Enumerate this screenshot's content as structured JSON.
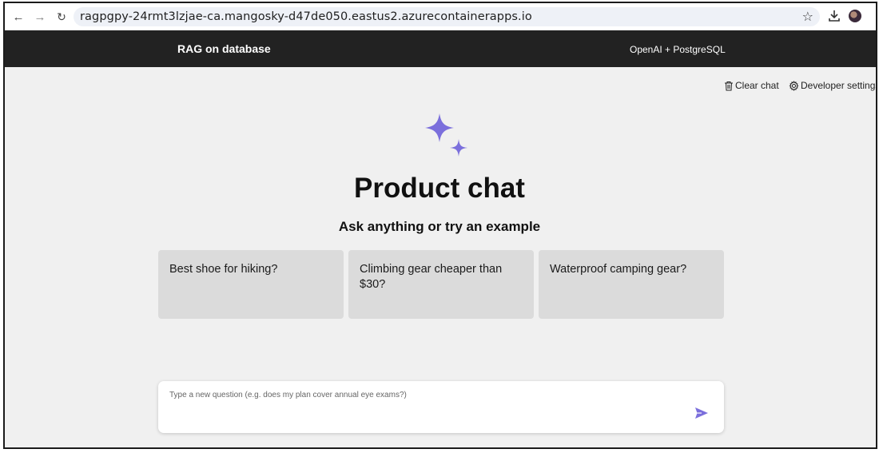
{
  "browser": {
    "url": "ragpgpy-24rmt3lzjae-ca.mangosky-d47de050.eastus2.azurecontainerapps.io",
    "back_icon": "arrow-left-icon",
    "forward_icon": "arrow-right-icon",
    "reload_icon": "reload-icon",
    "bookmark_icon": "star-icon",
    "download_icon": "download-icon",
    "menu_icon": "more-vertical-icon"
  },
  "header": {
    "title": "RAG on database",
    "subtitle": "OpenAI + PostgreSQL",
    "background": "#222222"
  },
  "commands": {
    "clear_label": "Clear chat",
    "clear_icon": "trash-icon",
    "developer_label": "Developer settings",
    "developer_icon": "gear-icon"
  },
  "main": {
    "logo_icon": "sparkle-icon",
    "logo_color": "#7b6fdc",
    "title": "Product chat",
    "subtitle": "Ask anything or try an example",
    "examples": [
      "Best shoe for hiking?",
      "Climbing gear cheaper than $30?",
      "Waterproof camping gear?"
    ]
  },
  "question": {
    "placeholder": "Type a new question (e.g. does my plan cover annual eye exams?)",
    "send_icon": "send-icon",
    "send_color": "#7b6fdc"
  }
}
